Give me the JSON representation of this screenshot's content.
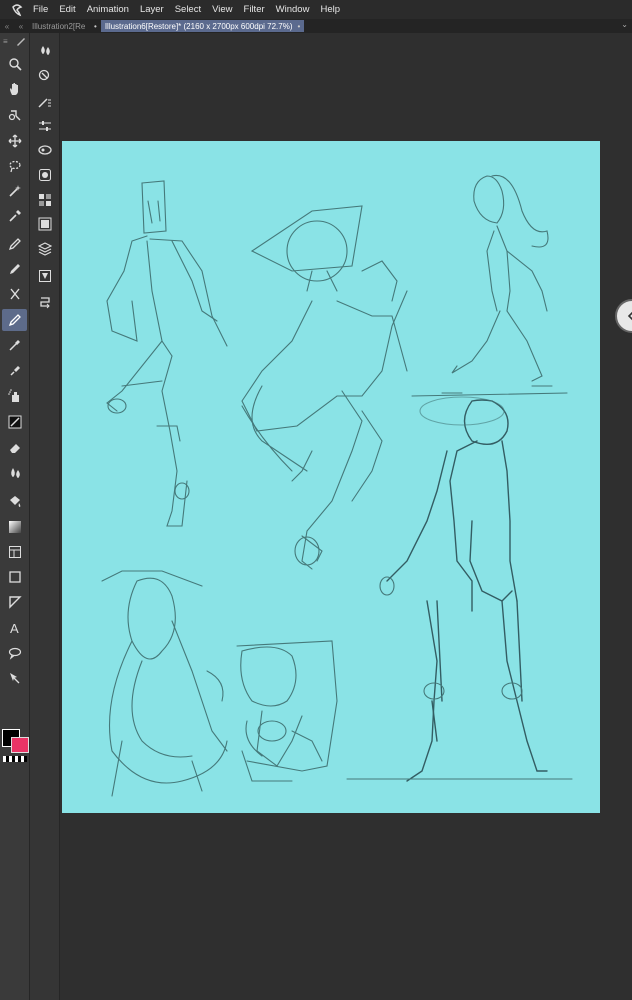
{
  "menubar": {
    "items": [
      "File",
      "Edit",
      "Animation",
      "Layer",
      "Select",
      "View",
      "Filter",
      "Window",
      "Help"
    ]
  },
  "tabs": [
    {
      "label": "Illustration2[Re",
      "close": "•"
    },
    {
      "label": "Illustration6[Restore]* (2160 x 2700px 600dpi 72.7%)",
      "close": "•"
    }
  ],
  "toolbar": {
    "icons": [
      "zoom-icon",
      "hand-icon",
      "rotate-icon",
      "move-icon",
      "lasso-icon",
      "magic-wand-icon",
      "eyedropper-icon",
      "pen-icon",
      "pencil-icon",
      "brush-icon",
      "marker-icon",
      "airbrush-icon",
      "decoration-icon",
      "eraser-icon",
      "blend-icon",
      "fill-icon",
      "gradient-icon",
      "frame-icon",
      "shape-icon",
      "ruler-icon",
      "text-icon",
      "balloon-icon",
      "operation-icon"
    ],
    "active": "marker-icon"
  },
  "colors": {
    "main": "#000000",
    "sub": "#ea3466"
  },
  "canvas": {
    "background": "#8ae3e6"
  }
}
